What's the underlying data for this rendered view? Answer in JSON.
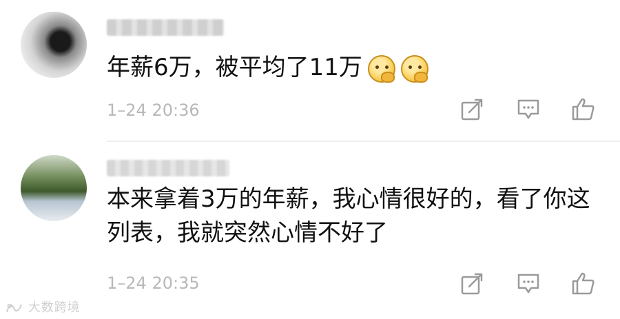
{
  "comments": [
    {
      "username": "",
      "content_text": "年薪6万，被平均了11万",
      "emojis": [
        "thinking-emoji",
        "thinking-emoji"
      ],
      "time": "1–24 20:36",
      "actions": [
        "share-icon",
        "reply-icon",
        "like-icon"
      ]
    },
    {
      "username": "",
      "content_text": "本来拿着3万的年薪，我心情很好的，看了你这列表，我就突然心情不好了",
      "emojis": [],
      "time": "1–24 20:35",
      "actions": [
        "share-icon",
        "reply-icon",
        "like-icon"
      ]
    }
  ],
  "watermark": {
    "text": "大数跨境"
  },
  "colors": {
    "text": "#111111",
    "timestamp": "#b8b8b8",
    "icon": "#9a9a9a",
    "divider": "#eeeeee"
  }
}
